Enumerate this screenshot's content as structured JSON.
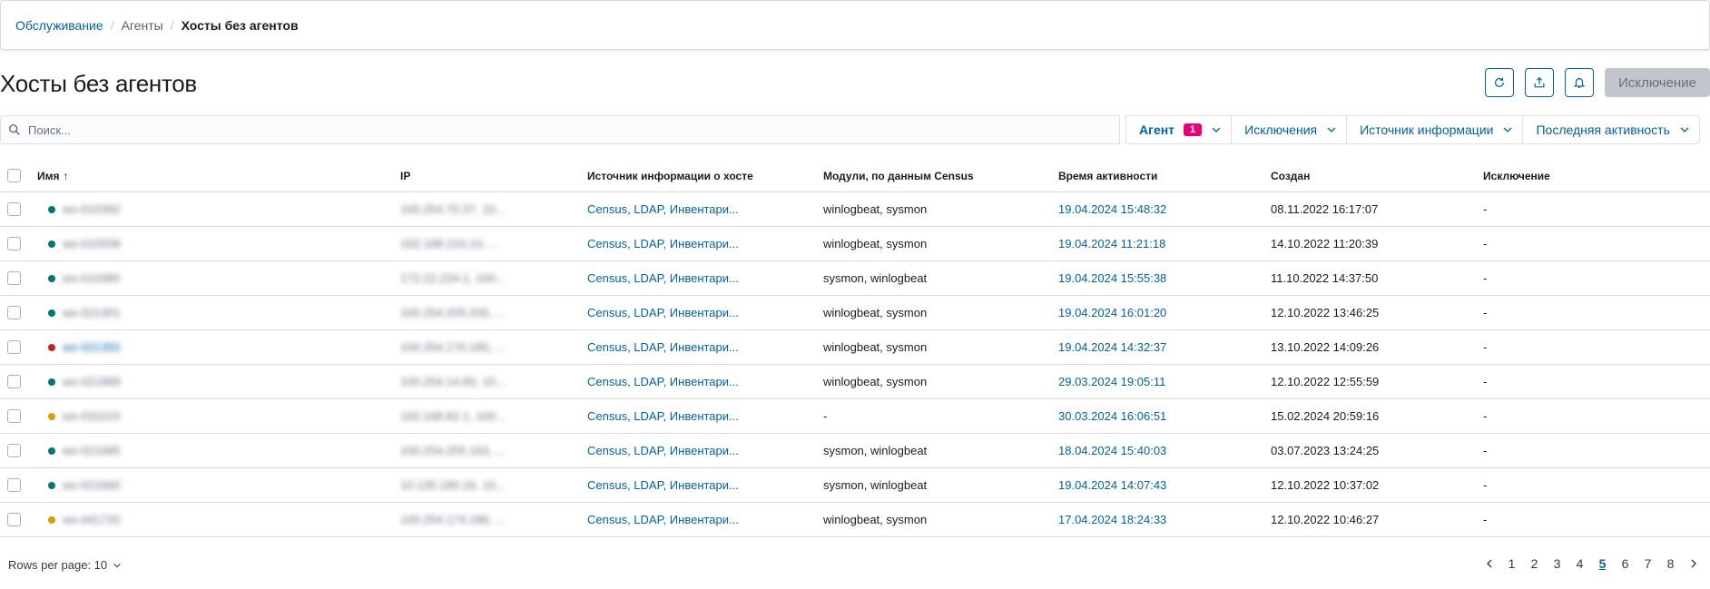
{
  "breadcrumb": {
    "items": [
      "Обслуживание",
      "Агенты",
      "Хосты без агентов"
    ],
    "separator": "/"
  },
  "page": {
    "title": "Хосты без агентов"
  },
  "actions": {
    "refresh_icon": "refresh-icon",
    "export_icon": "export-icon",
    "bell_icon": "bell-icon",
    "exclusion_label": "Исключение"
  },
  "search": {
    "placeholder": "Поиск...",
    "value": ""
  },
  "filters": [
    {
      "label": "Агент",
      "badge": "1",
      "active": true
    },
    {
      "label": "Исключения",
      "badge": "",
      "active": false
    },
    {
      "label": "Источник информации",
      "badge": "",
      "active": false
    },
    {
      "label": "Последняя активность",
      "badge": "",
      "active": false
    }
  ],
  "table": {
    "headers": {
      "name": "Имя",
      "ip": "IP",
      "source": "Источник информации о хосте",
      "modules": "Модули, по данным Census",
      "active": "Время активности",
      "created": "Создан",
      "exclusion": "Исключение"
    },
    "sort_indicator": "↑",
    "rows": [
      {
        "status": "#007871",
        "name": "ws-010392",
        "ip": "100.254.70.37, 10...",
        "source": "Census, LDAP, Инвентари...",
        "modules": "winlogbeat, sysmon",
        "active": "19.04.2024 15:48:32",
        "created": "08.11.2022 16:17:07",
        "exclusion": "-"
      },
      {
        "status": "#007871",
        "name": "ws-010558",
        "ip": "192.168.224.10, ...",
        "source": "Census, LDAP, Инвентари...",
        "modules": "winlogbeat, sysmon",
        "active": "19.04.2024 11:21:18",
        "created": "14.10.2022 11:20:39",
        "exclusion": "-"
      },
      {
        "status": "#007871",
        "name": "ws-010380",
        "ip": "172.22.224.1, 100...",
        "source": "Census, LDAP, Инвентари...",
        "modules": "sysmon, winlogbeat",
        "active": "19.04.2024 15:55:38",
        "created": "11.10.2022 14:37:50",
        "exclusion": "-"
      },
      {
        "status": "#007871",
        "name": "ws-021301",
        "ip": "100.254.205.205, ...",
        "source": "Census, LDAP, Инвентари...",
        "modules": "winlogbeat, sysmon",
        "active": "19.04.2024 16:01:20",
        "created": "12.10.2022 13:46:25",
        "exclusion": "-"
      },
      {
        "status": "#bd271e",
        "name": "ws-021350",
        "ip": "100.254.170.180, ...",
        "source": "Census, LDAP, Инвентари...",
        "modules": "winlogbeat, sysmon",
        "active": "19.04.2024 14:32:37",
        "created": "13.10.2022 14:09:26",
        "exclusion": "-"
      },
      {
        "status": "#007871",
        "name": "ws-021889",
        "ip": "100.254.14.80, 10...",
        "source": "Census, LDAP, Инвентари...",
        "modules": "winlogbeat, sysmon",
        "active": "29.03.2024 19:05:11",
        "created": "12.10.2022 12:55:59",
        "exclusion": "-"
      },
      {
        "status": "#d6a000",
        "name": "ws-031015",
        "ip": "192.168.82.1, 100...",
        "source": "Census, LDAP, Инвентари...",
        "modules": "-",
        "active": "30.03.2024 16:06:51",
        "created": "15.02.2024 20:59:16",
        "exclusion": "-"
      },
      {
        "status": "#007871",
        "name": "ws-021685",
        "ip": "100.254.255.163, ...",
        "source": "Census, LDAP, Инвентари...",
        "modules": "sysmon, winlogbeat",
        "active": "18.04.2024 15:40:03",
        "created": "03.07.2023 13:24:25",
        "exclusion": "-"
      },
      {
        "status": "#007871",
        "name": "ws-021660",
        "ip": "10.135.180.16, 10...",
        "source": "Census, LDAP, Инвентари...",
        "modules": "sysmon, winlogbeat",
        "active": "19.04.2024 14:07:43",
        "created": "12.10.2022 10:37:02",
        "exclusion": "-"
      },
      {
        "status": "#d6a000",
        "name": "ws-041720",
        "ip": "100.254.174.186, ...",
        "source": "Census, LDAP, Инвентари...",
        "modules": "winlogbeat, sysmon",
        "active": "17.04.2024 18:24:33",
        "created": "12.10.2022 10:46:27",
        "exclusion": "-"
      }
    ]
  },
  "pagination": {
    "rows_per_page_label": "Rows per page: 10",
    "pages": [
      "1",
      "2",
      "3",
      "4",
      "5",
      "6",
      "7",
      "8"
    ],
    "current": "5"
  }
}
